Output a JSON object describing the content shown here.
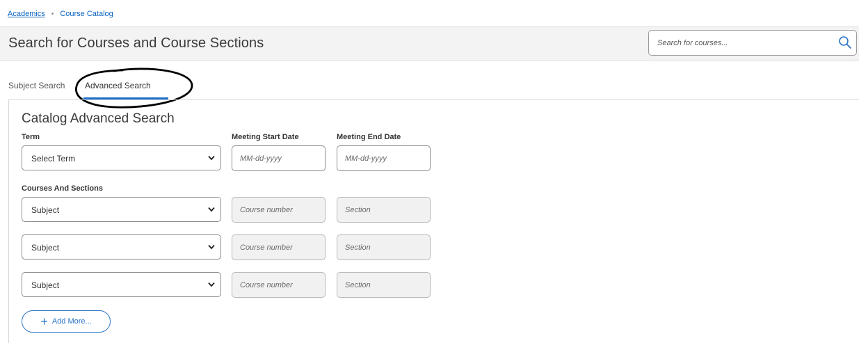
{
  "breadcrumb": {
    "home": "Academics",
    "separator": "•",
    "current": "Course Catalog"
  },
  "header": {
    "title": "Search for Courses and Course Sections",
    "search_placeholder": "Search for courses..."
  },
  "tabs": [
    {
      "label": "Subject Search",
      "active": false
    },
    {
      "label": "Advanced Search",
      "active": true
    }
  ],
  "form": {
    "title": "Catalog Advanced Search",
    "term_label": "Term",
    "term_value": "Select Term",
    "start_date_label": "Meeting Start Date",
    "start_date_placeholder": "MM-dd-yyyy",
    "end_date_label": "Meeting End Date",
    "end_date_placeholder": "MM-dd-yyyy",
    "courses_label": "Courses And Sections",
    "rows": [
      {
        "subject": "Subject",
        "course_placeholder": "Course number",
        "section_placeholder": "Section"
      },
      {
        "subject": "Subject",
        "course_placeholder": "Course number",
        "section_placeholder": "Section"
      },
      {
        "subject": "Subject",
        "course_placeholder": "Course number",
        "section_placeholder": "Section"
      }
    ],
    "add_more_label": "Add More..."
  },
  "colors": {
    "accent": "#1c6fc8",
    "link": "#0a63c2",
    "header_bg": "#f3f3f3"
  }
}
